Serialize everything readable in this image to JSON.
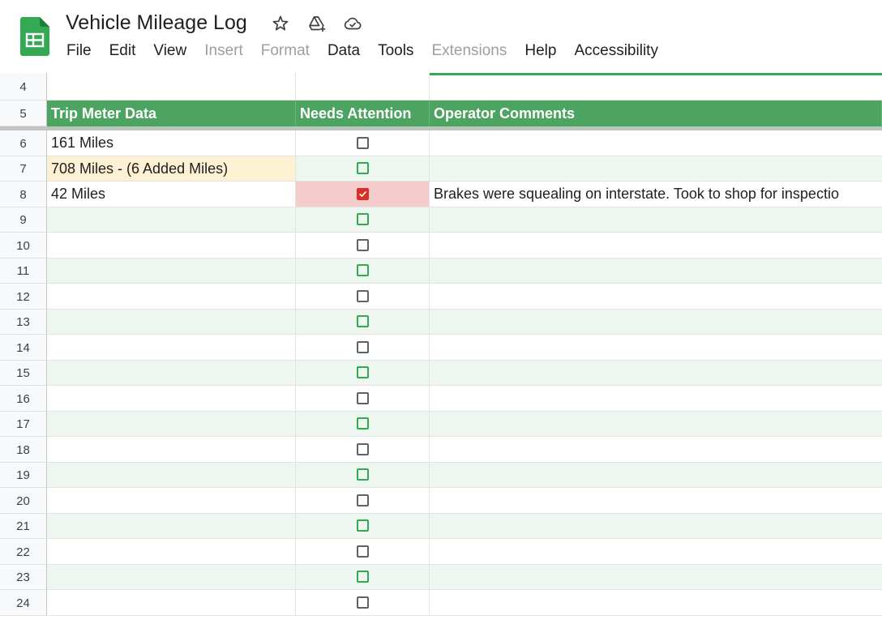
{
  "document": {
    "title": "Vehicle Mileage Log"
  },
  "menu": [
    {
      "label": "File",
      "enabled": true
    },
    {
      "label": "Edit",
      "enabled": true
    },
    {
      "label": "View",
      "enabled": true
    },
    {
      "label": "Insert",
      "enabled": false
    },
    {
      "label": "Format",
      "enabled": false
    },
    {
      "label": "Data",
      "enabled": true
    },
    {
      "label": "Tools",
      "enabled": true
    },
    {
      "label": "Extensions",
      "enabled": false
    },
    {
      "label": "Help",
      "enabled": true
    },
    {
      "label": "Accessibility",
      "enabled": true
    }
  ],
  "icons": {
    "app": "google-sheets-icon",
    "star": "star-icon",
    "move": "move-to-drive-icon",
    "cloud": "cloud-saved-icon"
  },
  "colors": {
    "header_fill": "#4da360",
    "band_fill": "#edf6ef",
    "highlight_fill": "#fdf1d3",
    "alert_fill": "#f4cccc",
    "checked": "#d93025"
  },
  "sheet": {
    "blank_row": {
      "number": "4"
    },
    "header": {
      "number": "5",
      "columns": [
        "Trip Meter Data",
        "Needs Attention",
        "Operator Comments"
      ]
    },
    "rows": [
      {
        "number": "6",
        "trip": "161 Miles",
        "attention": false,
        "comment": "",
        "style": "normal"
      },
      {
        "number": "7",
        "trip": "708 Miles - (6 Added Miles)",
        "attention": false,
        "comment": "",
        "style": "highlight"
      },
      {
        "number": "8",
        "trip": "42 Miles",
        "attention": true,
        "comment": "Brakes were squealing on interstate. Took to shop for inspectio",
        "style": "alert"
      },
      {
        "number": "9",
        "trip": "",
        "attention": false,
        "comment": "",
        "style": "normal"
      },
      {
        "number": "10",
        "trip": "",
        "attention": false,
        "comment": "",
        "style": "normal"
      },
      {
        "number": "11",
        "trip": "",
        "attention": false,
        "comment": "",
        "style": "normal"
      },
      {
        "number": "12",
        "trip": "",
        "attention": false,
        "comment": "",
        "style": "normal"
      },
      {
        "number": "13",
        "trip": "",
        "attention": false,
        "comment": "",
        "style": "normal"
      },
      {
        "number": "14",
        "trip": "",
        "attention": false,
        "comment": "",
        "style": "normal"
      },
      {
        "number": "15",
        "trip": "",
        "attention": false,
        "comment": "",
        "style": "normal"
      },
      {
        "number": "16",
        "trip": "",
        "attention": false,
        "comment": "",
        "style": "normal"
      },
      {
        "number": "17",
        "trip": "",
        "attention": false,
        "comment": "",
        "style": "normal"
      },
      {
        "number": "18",
        "trip": "",
        "attention": false,
        "comment": "",
        "style": "normal"
      },
      {
        "number": "19",
        "trip": "",
        "attention": false,
        "comment": "",
        "style": "normal"
      },
      {
        "number": "20",
        "trip": "",
        "attention": false,
        "comment": "",
        "style": "normal"
      },
      {
        "number": "21",
        "trip": "",
        "attention": false,
        "comment": "",
        "style": "normal"
      },
      {
        "number": "22",
        "trip": "",
        "attention": false,
        "comment": "",
        "style": "normal"
      },
      {
        "number": "23",
        "trip": "",
        "attention": false,
        "comment": "",
        "style": "normal"
      },
      {
        "number": "24",
        "trip": "",
        "attention": false,
        "comment": "",
        "style": "normal"
      }
    ]
  }
}
